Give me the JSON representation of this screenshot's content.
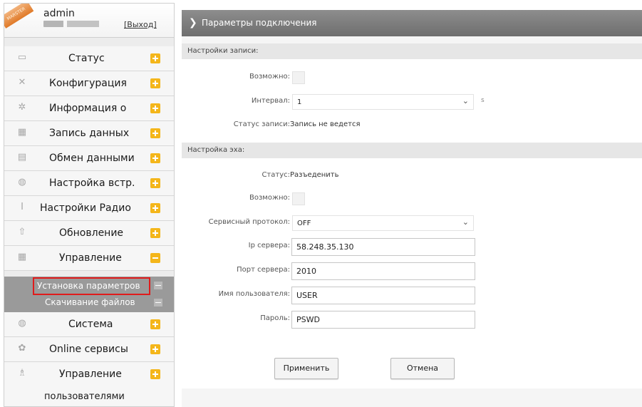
{
  "user": {
    "ribbon_text": "MARSTER",
    "name": "admin",
    "logout": "[Выход]"
  },
  "menu": {
    "items": [
      {
        "label": "Статус",
        "icon": "monitor-icon"
      },
      {
        "label": "Конфигурация",
        "icon": "tools-icon"
      },
      {
        "label": "Информация о",
        "icon": "gear-icon"
      },
      {
        "label": "Запись данных",
        "icon": "calendar-icon"
      },
      {
        "label": "Обмен данными",
        "icon": "computer-icon"
      },
      {
        "label": "Настройка встр.",
        "icon": "globe-icon"
      },
      {
        "label": "Настройки Радио",
        "icon": "antenna-icon"
      },
      {
        "label": "Обновление",
        "icon": "upload-icon"
      },
      {
        "label": "Управление",
        "icon": "calendar-icon",
        "expanded": true
      },
      {
        "label": "Система",
        "icon": "globe-icon"
      },
      {
        "label": "Online сервисы",
        "icon": "cloud-icon"
      },
      {
        "label": "Управление",
        "icon": "users-icon"
      }
    ],
    "sub_items": [
      {
        "label": "Установка параметров",
        "selected": true
      },
      {
        "label": "Скачивание файлов"
      }
    ],
    "tail_label": "пользователями"
  },
  "header": {
    "title": "Параметры подключения"
  },
  "record_section": {
    "title": "Настройки записи:",
    "enable_label": "Возможно:",
    "interval_label": "Интервал:",
    "interval_value": "1",
    "interval_unit": "s",
    "status_label": "Статус записи:",
    "status_value": "Запись не ведется"
  },
  "echo_section": {
    "title": "Настройка эха:",
    "status_label": "Статус:",
    "status_value": "Разъеденить",
    "enable_label": "Возможно:",
    "protocol_label": "Сервисный протокол:",
    "protocol_value": "OFF",
    "ip_label": "Ip сервера:",
    "ip_value": "58.248.35.130",
    "port_label": "Порт сервера:",
    "port_value": "2010",
    "user_label": "Имя пользователя:",
    "user_value": "USER",
    "password_label": "Пароль:",
    "password_value": "PSWD"
  },
  "buttons": {
    "apply": "Применить",
    "cancel": "Отмена"
  },
  "colors": {
    "header_bar": "#7d7d7d",
    "plus_badge": "#f4b61a",
    "selection_outline": "#e01b1b",
    "submenu_bg": "#9a9a9a"
  }
}
